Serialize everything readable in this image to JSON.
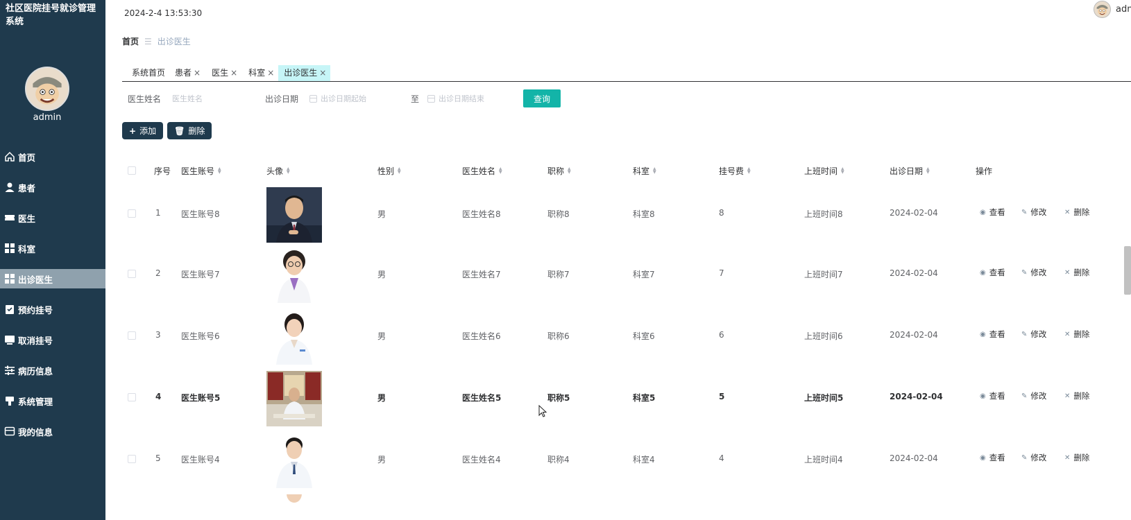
{
  "app": {
    "title": "社区医院挂号就诊管理系统",
    "username": "admin"
  },
  "header": {
    "datetime": "2024-2-4 13:53:30",
    "username": "admin"
  },
  "sidebar": {
    "items": [
      {
        "label": "首页",
        "icon": "home-icon"
      },
      {
        "label": "患者",
        "icon": "user-icon"
      },
      {
        "label": "医生",
        "icon": "ticket-icon"
      },
      {
        "label": "科室",
        "icon": "grid-icon"
      },
      {
        "label": "出诊医生",
        "icon": "grid-icon"
      },
      {
        "label": "预约挂号",
        "icon": "clipboard-icon"
      },
      {
        "label": "取消挂号",
        "icon": "monitor-icon"
      },
      {
        "label": "病历信息",
        "icon": "sliders-icon"
      },
      {
        "label": "系统管理",
        "icon": "stamp-icon"
      },
      {
        "label": "我的信息",
        "icon": "wallet-icon"
      }
    ],
    "active": "出诊医生"
  },
  "breadcrumb": {
    "home": "首页",
    "separator": "☰",
    "current": "出诊医生"
  },
  "tabs": [
    {
      "label": "系统首页",
      "closable": false
    },
    {
      "label": "患者",
      "closable": true
    },
    {
      "label": "医生",
      "closable": true
    },
    {
      "label": "科室",
      "closable": true
    },
    {
      "label": "出诊医生",
      "closable": true,
      "active": true
    }
  ],
  "search": {
    "name_label": "医生姓名",
    "name_placeholder": "医生姓名",
    "date_label": "出诊日期",
    "date_start_placeholder": "出诊日期起始",
    "date_to": "至",
    "date_end_placeholder": "出诊日期结束",
    "query_label": "查询"
  },
  "actions": {
    "add_label": "添加",
    "delete_label": "删除"
  },
  "table": {
    "headers": [
      "序号",
      "医生账号",
      "头像",
      "性别",
      "医生姓名",
      "职称",
      "科室",
      "挂号费",
      "上班时间",
      "出诊日期",
      "操作"
    ],
    "ops": {
      "view": "查看",
      "edit": "修改",
      "delete": "删除"
    },
    "rows": [
      {
        "index": "1",
        "account": "医生账号8",
        "gender": "男",
        "name": "医生姓名8",
        "title": "职称8",
        "dept": "科室8",
        "fee": "8",
        "shift": "上班时间8",
        "date": "2024-02-04"
      },
      {
        "index": "2",
        "account": "医生账号7",
        "gender": "男",
        "name": "医生姓名7",
        "title": "职称7",
        "dept": "科室7",
        "fee": "7",
        "shift": "上班时间7",
        "date": "2024-02-04"
      },
      {
        "index": "3",
        "account": "医生账号6",
        "gender": "男",
        "name": "医生姓名6",
        "title": "职称6",
        "dept": "科室6",
        "fee": "6",
        "shift": "上班时间6",
        "date": "2024-02-04"
      },
      {
        "index": "4",
        "account": "医生账号5",
        "gender": "男",
        "name": "医生姓名5",
        "title": "职称5",
        "dept": "科室5",
        "fee": "5",
        "shift": "上班时间5",
        "date": "2024-02-04"
      },
      {
        "index": "5",
        "account": "医生账号4",
        "gender": "男",
        "name": "医生姓名4",
        "title": "职称4",
        "dept": "科室4",
        "fee": "4",
        "shift": "上班时间4",
        "date": "2024-02-04"
      }
    ]
  },
  "colors": {
    "sidebar": "#1f3a4d",
    "active_menu": "#8fa1ad",
    "accent": "#13b4a8",
    "active_tab": "#c6f5f7"
  }
}
